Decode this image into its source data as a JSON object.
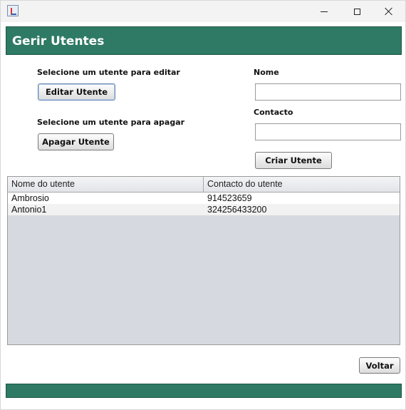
{
  "window": {
    "icon": "java-icon",
    "controls": [
      "minimize-icon",
      "maximize-icon",
      "close-icon"
    ]
  },
  "header": {
    "title": "Gerir Utentes",
    "color": "#2e7a64"
  },
  "edit": {
    "prompt": "Selecione um utente para editar",
    "button_label": "Editar Utente"
  },
  "delete": {
    "prompt": "Selecione um utente para apagar",
    "button_label": "Apagar Utente"
  },
  "form": {
    "name_label": "Nome",
    "name_value": "",
    "contact_label": "Contacto",
    "contact_value": "",
    "create_label": "Criar Utente"
  },
  "table": {
    "columns": [
      "Nome do utente",
      "Contacto do utente"
    ],
    "rows": [
      [
        "Ambrosio",
        "914523659"
      ],
      [
        "Antonio1",
        "324256433200"
      ]
    ]
  },
  "footer": {
    "back_label": "Voltar"
  }
}
